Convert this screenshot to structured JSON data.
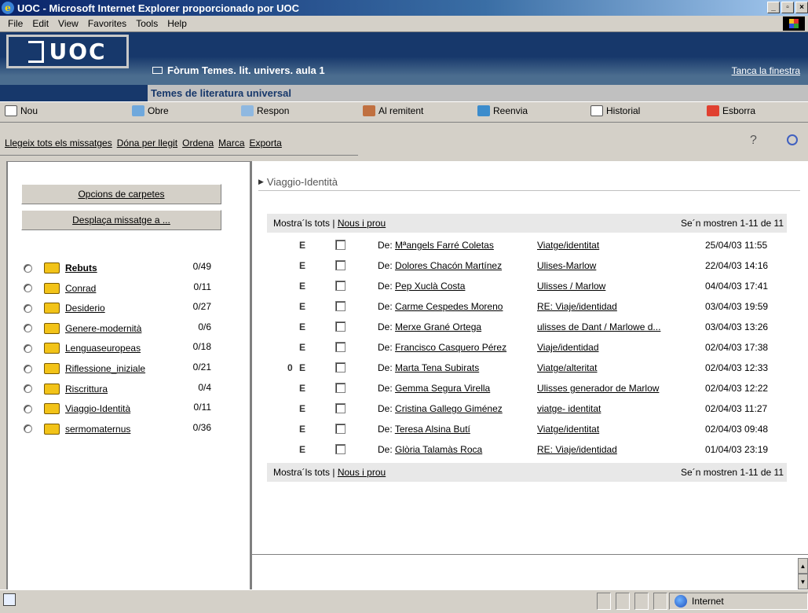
{
  "window": {
    "title": "UOC - Microsoft Internet Explorer proporcionado por UOC"
  },
  "menu": [
    "File",
    "Edit",
    "View",
    "Favorites",
    "Tools",
    "Help"
  ],
  "header": {
    "logo_text": "UOC",
    "forum_title": "Fòrum Temes. lit. univers. aula 1",
    "close_link": "Tanca la finestra",
    "subtitle": "Temes de literatura universal"
  },
  "toolbar": {
    "new": "Nou",
    "open": "Obre",
    "reply": "Respon",
    "to_sender": "Al remitent",
    "forward": "Reenvia",
    "history": "Historial",
    "delete": "Esborra"
  },
  "actions": [
    "Llegeix tots els missatges",
    "Dóna per llegit",
    "Ordena",
    "Marca",
    "Exporta"
  ],
  "left": {
    "folder_options": "Opcions de carpetes",
    "move_message": "Desplaça missatge a ...",
    "folders": [
      {
        "name": "Rebuts",
        "count": "0/49"
      },
      {
        "name": "Conrad",
        "count": "0/11"
      },
      {
        "name": "Desiderio",
        "count": "0/27"
      },
      {
        "name": "Genere-modernità",
        "count": "0/6"
      },
      {
        "name": "Lenguaseuropeas",
        "count": "0/18"
      },
      {
        "name": "Riflessione_iniziale",
        "count": "0/21"
      },
      {
        "name": "Riscrittura",
        "count": "0/4"
      },
      {
        "name": "Viaggio-Identità",
        "count": "0/11"
      },
      {
        "name": "sermomaternus",
        "count": "0/36"
      }
    ]
  },
  "right": {
    "folder_title": "Viaggio-Identità",
    "show_all": "Mostra´ls tots",
    "sep": "|",
    "only_new": "Nous i prou",
    "showing": "Se´n mostren 1-11 de 11",
    "msg_flag": "E",
    "from_prefix": "De:",
    "messages": [
      {
        "from": "Mªangels Farré Coletas",
        "subject": "Viatge/identitat",
        "date": "25/04/03 11:55",
        "attach": false
      },
      {
        "from": "Dolores Chacón Martínez",
        "subject": "Ulises-Marlow",
        "date": "22/04/03 14:16",
        "attach": false
      },
      {
        "from": "Pep Xuclà Costa",
        "subject": "Ulisses / Marlow",
        "date": "04/04/03 17:41",
        "attach": false
      },
      {
        "from": "Carme Cespedes Moreno",
        "subject": "RE: Viaje/identidad",
        "date": "03/04/03 19:59",
        "attach": false
      },
      {
        "from": "Merxe Grané Ortega",
        "subject": "ulisses de Dant / Marlowe d...",
        "date": "03/04/03 13:26",
        "attach": false
      },
      {
        "from": "Francisco Casquero Pérez",
        "subject": "Viaje/identidad",
        "date": "02/04/03 17:38",
        "attach": false
      },
      {
        "from": "Marta Tena Subirats",
        "subject": "Viatge/alteritat",
        "date": "02/04/03 12:33",
        "attach": true
      },
      {
        "from": "Gemma Segura Virella",
        "subject": "Ulisses generador de Marlow",
        "date": "02/04/03 12:22",
        "attach": false
      },
      {
        "from": "Cristina Gallego Giménez",
        "subject": "viatge- identitat",
        "date": "02/04/03 11:27",
        "attach": false
      },
      {
        "from": "Teresa Alsina Butí",
        "subject": "Viatge/identitat",
        "date": "02/04/03 09:48",
        "attach": false
      },
      {
        "from": "Glòria Talamàs Roca",
        "subject": "RE: Viaje/identidad",
        "date": "01/04/03 23:19",
        "attach": false
      }
    ]
  },
  "status": {
    "zone": "Internet"
  },
  "colors": {
    "brand": "#17386b",
    "band": "#4b6d8f",
    "folder": "#f2c318"
  }
}
